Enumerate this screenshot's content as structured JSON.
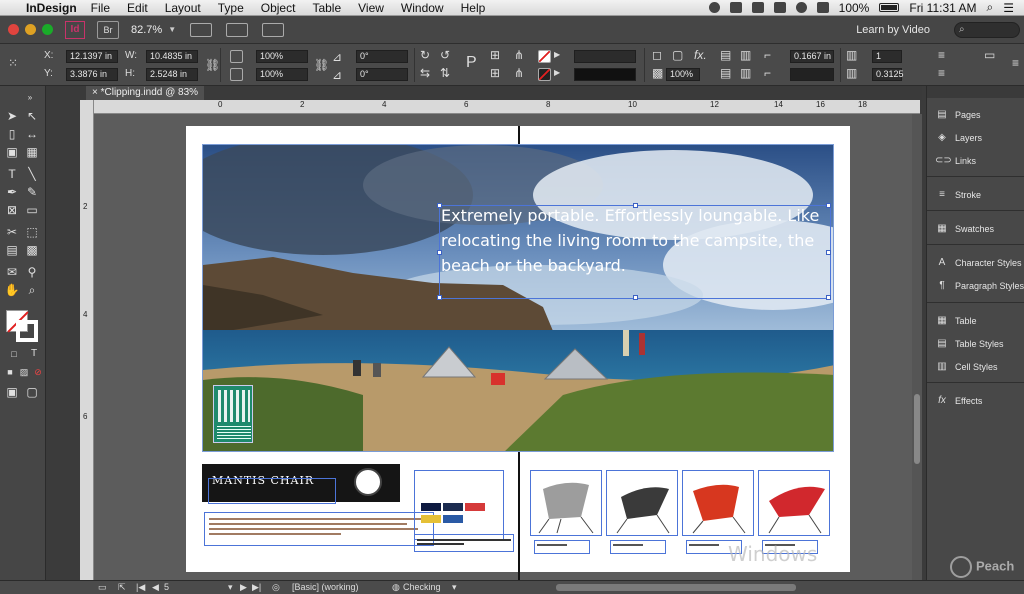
{
  "menubar": {
    "app_name": "InDesign",
    "items": [
      "File",
      "Edit",
      "Layout",
      "Type",
      "Object",
      "Table",
      "View",
      "Window",
      "Help"
    ],
    "battery": "100%",
    "clock": "Fri 11:31 AM"
  },
  "appbar": {
    "logo": "Id",
    "bridge": "Br",
    "zoom": "82.7%",
    "workspace": "Learn by Video",
    "search_placeholder": ""
  },
  "control": {
    "x_label": "X:",
    "x_value": "12.1397 in",
    "y_label": "Y:",
    "y_value": "3.3876 in",
    "w_label": "W:",
    "w_value": "10.4835 in",
    "h_label": "H:",
    "h_value": "2.5248 in",
    "scale_x": "100%",
    "scale_y": "100%",
    "rotate": "0°",
    "shear": "0°",
    "stroke_weight": "",
    "opacity": "100%",
    "inset": "0.1667 in",
    "columns": "1",
    "gutter": "0.3125"
  },
  "document": {
    "tab_label": "*Clipping.indd @ 83%",
    "ruler_marks": [
      "0",
      "2",
      "4",
      "6",
      "8",
      "10",
      "12",
      "14",
      "16",
      "18"
    ],
    "vruler_marks": [
      "2",
      "4",
      "6"
    ],
    "headline": "Extremely portable. Effortlessly loungable. Like relocating the living room to the campsite, the beach or the backyard.",
    "product_title": "MANTIS CHAIR",
    "watermark": "Windows"
  },
  "panels": {
    "items": [
      {
        "label": "Pages",
        "icon": "pages-icon",
        "glyph": "▤"
      },
      {
        "label": "Layers",
        "icon": "layers-icon",
        "glyph": "◈"
      },
      {
        "label": "Links",
        "icon": "links-icon",
        "glyph": "⊂⊃"
      },
      {
        "label": "Stroke",
        "icon": "stroke-icon",
        "glyph": "≡"
      },
      {
        "label": "Swatches",
        "icon": "swatches-icon",
        "glyph": "▦"
      },
      {
        "label": "Character Styles",
        "icon": "character-styles-icon",
        "glyph": "A"
      },
      {
        "label": "Paragraph Styles",
        "icon": "paragraph-styles-icon",
        "glyph": "¶"
      },
      {
        "label": "Table",
        "icon": "table-icon",
        "glyph": "▦"
      },
      {
        "label": "Table Styles",
        "icon": "table-styles-icon",
        "glyph": "▤"
      },
      {
        "label": "Cell Styles",
        "icon": "cell-styles-icon",
        "glyph": "▥"
      },
      {
        "label": "Effects",
        "icon": "effects-icon",
        "glyph": "fx"
      }
    ]
  },
  "statusbar": {
    "page_number": "5",
    "style": "[Basic] (working)",
    "preflight": "Checking"
  },
  "branding": {
    "peachpit": "Peach"
  },
  "colors": {
    "selection": "#4c74d8",
    "indesign_pink": "#c8336a"
  }
}
